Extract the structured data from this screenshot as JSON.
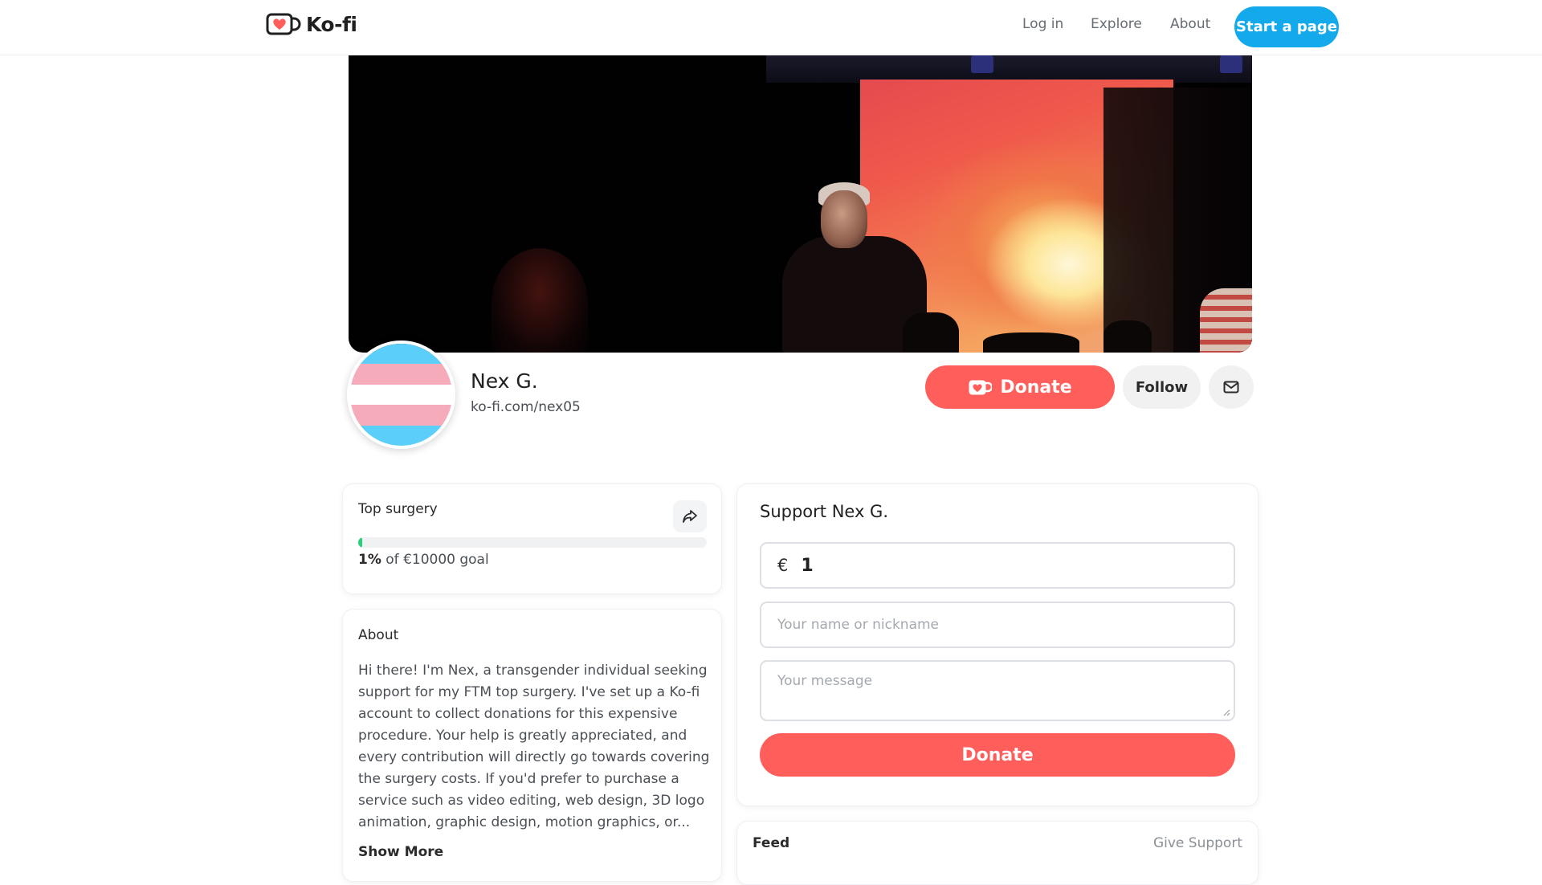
{
  "nav": {
    "logo_text": "Ko-fi",
    "links": [
      "Log in",
      "Explore",
      "About"
    ],
    "start_button": "Start a page"
  },
  "colors": {
    "accent_blue": "#13a9eb",
    "donate_red": "#ff5e5b",
    "progress_green": "#29d07a",
    "flag_blue": "#5bcffa",
    "flag_pink": "#f5abb9",
    "flag_white": "#ffffff"
  },
  "icons": [
    "kofi-cup-icon",
    "heart-icon",
    "mail-icon",
    "share-icon",
    "resize-grip-icon"
  ],
  "profile": {
    "name": "Nex G.",
    "url": "ko-fi.com/nex05",
    "donate_label": "Donate",
    "follow_label": "Follow"
  },
  "goal": {
    "title": "Top surgery",
    "percent_label": "1%",
    "goal_suffix": "of €10000 goal",
    "progress_fraction": 0.01
  },
  "about": {
    "title": "About",
    "text": "Hi there! I'm Nex, a transgender individual seeking support for my FTM top surgery. I've set up a Ko-fi account to collect donations for this expensive procedure. Your help is greatly appreciated, and every contribution will directly go towards covering the surgery costs. If you'd prefer to purchase a service such as video editing, web design, 3D logo animation, graphic design, motion graphics, or...",
    "show_more": "Show More"
  },
  "support": {
    "title": "Support Nex G.",
    "currency": "€",
    "amount": "1",
    "name_placeholder": "Your name or nickname",
    "message_placeholder": "Your message",
    "donate_label": "Donate"
  },
  "feed": {
    "title": "Feed",
    "give_support": "Give Support"
  }
}
